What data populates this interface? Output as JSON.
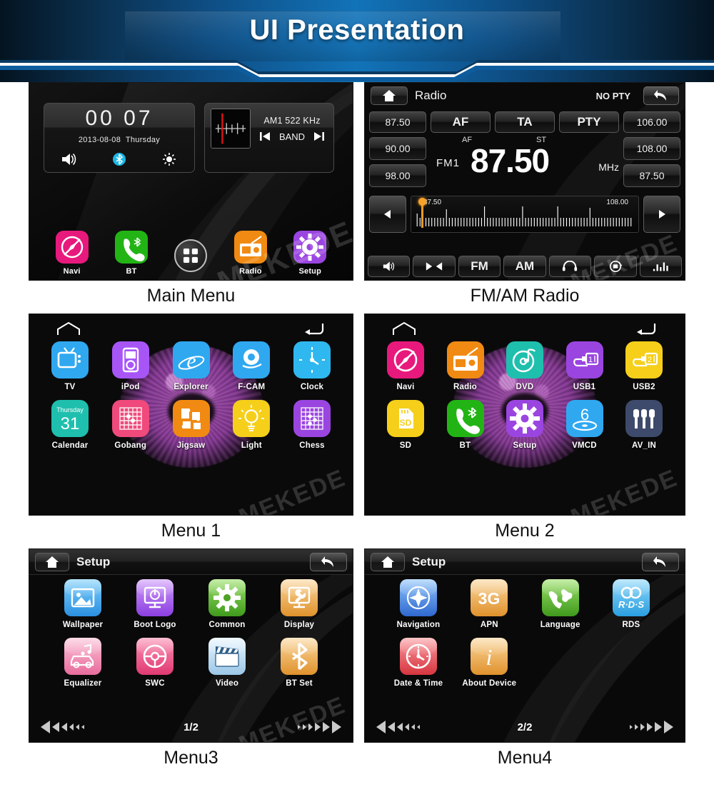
{
  "banner": {
    "title": "UI Presentation",
    "accent": "#1273b8"
  },
  "panels": [
    {
      "caption": "Main Menu"
    },
    {
      "caption": "FM/AM Radio"
    },
    {
      "caption": "Menu 1"
    },
    {
      "caption": "Menu 2"
    },
    {
      "caption": "Menu3"
    },
    {
      "caption": "Menu4"
    }
  ],
  "watermark": "MEKEDE",
  "main_menu": {
    "clock": {
      "time": "00 07",
      "date": "2013-08-08",
      "weekday": "Thursday",
      "icons": [
        "volume-icon",
        "bluetooth-icon",
        "brightness-icon"
      ]
    },
    "radio_widget": {
      "band_text": "AM1 522 KHz",
      "prev_label": "prev-icon",
      "band_label": "BAND",
      "next_label": "next-icon"
    },
    "dock": [
      {
        "label": "Navi",
        "icon": "compass-icon",
        "color": "#e8197d"
      },
      {
        "label": "BT",
        "icon": "phone-bt-icon",
        "color": "#22b415"
      },
      {
        "label": "",
        "icon": "apps-grid-icon",
        "color": "#1a1a1a"
      },
      {
        "label": "Radio",
        "icon": "radio-icon",
        "color": "#f08a13"
      },
      {
        "label": "Setup",
        "icon": "gear-icon",
        "color": "#9a45e0"
      }
    ]
  },
  "radio": {
    "home_label": "home-icon",
    "title": "Radio",
    "pty_status": "NO PTY",
    "back_label": "back-icon",
    "top_row": [
      {
        "label": "87.50",
        "type": "preset"
      },
      {
        "label": "AF",
        "type": "function"
      },
      {
        "label": "TA",
        "type": "function"
      },
      {
        "label": "PTY",
        "type": "function"
      },
      {
        "label": "106.00",
        "type": "preset"
      }
    ],
    "left_presets": [
      "90.00",
      "98.00"
    ],
    "right_presets": [
      "108.00",
      "87.50"
    ],
    "display": {
      "af_flag": "AF",
      "st_flag": "ST",
      "band": "FM1",
      "frequency": "87.50",
      "unit": "MHz"
    },
    "scale": {
      "min_label": "87.50",
      "max_label": "108.00",
      "marker_position_pct": 2
    },
    "bottom_bar": [
      {
        "label": "",
        "icon": "volume-icon"
      },
      {
        "label": "",
        "icon": "seek-icon"
      },
      {
        "label": "FM",
        "icon": ""
      },
      {
        "label": "AM",
        "icon": ""
      },
      {
        "label": "",
        "icon": "headphone-icon"
      },
      {
        "label": "",
        "icon": "scan-icon"
      },
      {
        "label": "",
        "icon": "equalizer-icon"
      }
    ]
  },
  "menu1": {
    "home_icon": "home-outline-icon",
    "back_icon": "back-arrow-icon",
    "rows": [
      [
        {
          "label": "TV",
          "icon": "tv-icon",
          "color": "#2fa8f0"
        },
        {
          "label": "iPod",
          "icon": "ipod-icon",
          "color": "#a855f7"
        },
        {
          "label": "Explorer",
          "icon": "explorer-icon",
          "color": "#2fa8f0"
        },
        {
          "label": "F-CAM",
          "icon": "camera-icon",
          "color": "#2fa8f0"
        },
        {
          "label": "Clock",
          "icon": "clock-icon",
          "color": "#2fb8f0"
        }
      ],
      [
        {
          "label": "Calendar",
          "icon": "calendar-icon",
          "color": "#1fbfae",
          "day": "Thursday",
          "date": "31"
        },
        {
          "label": "Gobang",
          "icon": "gobang-icon",
          "color": "#ef4a7b"
        },
        {
          "label": "Jigsaw",
          "icon": "jigsaw-icon",
          "color": "#f08a13"
        },
        {
          "label": "Light",
          "icon": "bulb-icon",
          "color": "#f5cf1a"
        },
        {
          "label": "Chess",
          "icon": "chess-icon",
          "color": "#9a45e0"
        }
      ]
    ]
  },
  "menu2": {
    "home_icon": "home-outline-icon",
    "back_icon": "back-arrow-icon",
    "rows": [
      [
        {
          "label": "Navi",
          "icon": "compass-icon",
          "color": "#e8197d"
        },
        {
          "label": "Radio",
          "icon": "radio-icon",
          "color": "#f08a13"
        },
        {
          "label": "DVD",
          "icon": "dvd-icon",
          "color": "#1fbfae"
        },
        {
          "label": "USB1",
          "icon": "usb1-icon",
          "color": "#9a45e0"
        },
        {
          "label": "USB2",
          "icon": "usb2-icon",
          "color": "#f5cf1a"
        }
      ],
      [
        {
          "label": "SD",
          "icon": "sd-icon",
          "color": "#f5cf1a"
        },
        {
          "label": "BT",
          "icon": "phone-bt-icon",
          "color": "#22b415"
        },
        {
          "label": "Setup",
          "icon": "gear-icon",
          "color": "#9a45e0"
        },
        {
          "label": "VMCD",
          "icon": "vmcd-icon",
          "color": "#2fa8f0"
        },
        {
          "label": "AV_IN",
          "icon": "avin-icon",
          "color": "#3d4a6b"
        }
      ]
    ]
  },
  "menu3": {
    "home_icon": "home-icon",
    "title": "Setup",
    "back_icon": "back-icon",
    "page": "1/2",
    "rows": [
      [
        {
          "label": "Wallpaper",
          "icon": "image-icon",
          "color": "#3ba7ef"
        },
        {
          "label": "Boot Logo",
          "icon": "power-monitor-icon",
          "color": "#a95ae8"
        },
        {
          "label": "Common",
          "icon": "gear-icon",
          "color": "#5cb838"
        },
        {
          "label": "Display",
          "icon": "display-wrench-icon",
          "color": "#f0a94a"
        }
      ],
      [
        {
          "label": "Equalizer",
          "icon": "car-music-icon",
          "color": "#ef82a8"
        },
        {
          "label": "SWC",
          "icon": "steering-icon",
          "color": "#ef4a7b"
        },
        {
          "label": "Video",
          "icon": "clapper-icon",
          "color": "#bcdcf5"
        },
        {
          "label": "BT Set",
          "icon": "bluetooth-icon",
          "color": "#f0a94a"
        }
      ]
    ]
  },
  "menu4": {
    "home_icon": "home-icon",
    "title": "Setup",
    "back_icon": "back-icon",
    "page": "2/2",
    "rows": [
      [
        {
          "label": "Navigation",
          "icon": "compass-nav-icon",
          "color": "#3b7fe0"
        },
        {
          "label": "APN",
          "icon": "3g-icon",
          "color": "#f0a94a",
          "text": "3G"
        },
        {
          "label": "Language",
          "icon": "globe-icon",
          "color": "#5cb838"
        },
        {
          "label": "RDS",
          "icon": "rds-icon",
          "color": "#3ba7ef",
          "text": "RDS"
        }
      ],
      [
        {
          "label": "Date & Time",
          "icon": "analog-clock-icon",
          "color": "#e8535c"
        },
        {
          "label": "About Device",
          "icon": "info-icon",
          "color": "#f0a94a",
          "text": "i"
        }
      ]
    ]
  }
}
